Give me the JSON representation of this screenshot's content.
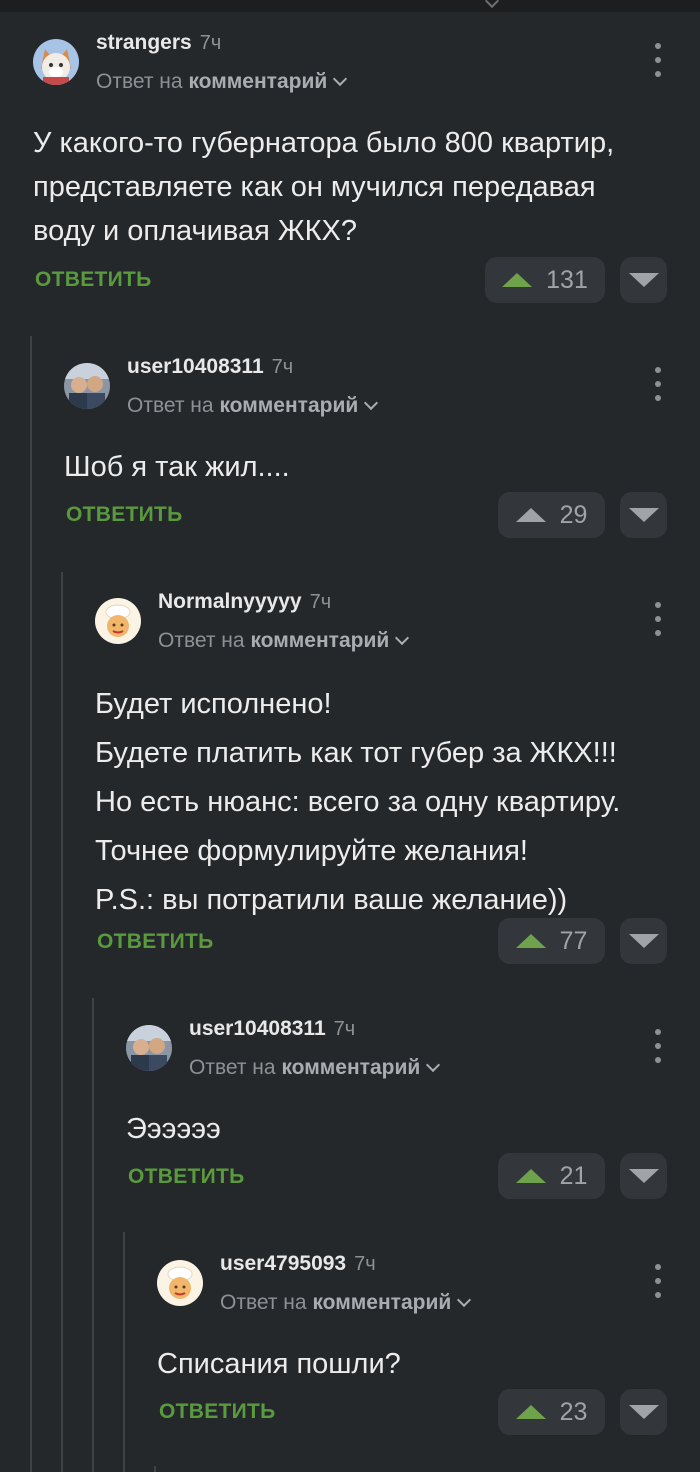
{
  "colors": {
    "background": "#25282b",
    "reply_green": "#5a9a3e",
    "upvote_green": "#6ea34c"
  },
  "comments": [
    {
      "username": "strangers",
      "time": "7ч",
      "reply_prefix": "Ответ на",
      "reply_target": "комментарий",
      "lines": [
        "У какого-то губернатора было 800 квартир,",
        "представляете как он мучился передавая",
        "воду и оплачивая ЖКХ?"
      ],
      "reply_label": "ОТВЕТИТЬ",
      "votes": "131",
      "upvoted": true,
      "avatar": "fox-avatar"
    },
    {
      "username": "user10408311",
      "time": "7ч",
      "reply_prefix": "Ответ на",
      "reply_target": "комментарий",
      "lines": [
        "Шоб я так жил...."
      ],
      "reply_label": "ОТВЕТИТЬ",
      "votes": "29",
      "upvoted": false,
      "avatar": "photo-avatar"
    },
    {
      "username": "Normalnyyyyy",
      "time": "7ч",
      "reply_prefix": "Ответ на",
      "reply_target": "комментарий",
      "lines": [
        "Будет исполнено!",
        "Будете платить как тот губер за ЖКХ!!!",
        "Но есть нюанс: всего за одну квартиру.",
        "Точнее формулируйте желания!",
        "P.S.: вы потратили ваше желание))"
      ],
      "reply_label": "ОТВЕТИТЬ",
      "votes": "77",
      "upvoted": true,
      "avatar": "chef-avatar"
    },
    {
      "username": "user10408311",
      "time": "7ч",
      "reply_prefix": "Ответ на",
      "reply_target": "комментарий",
      "lines": [
        "Ээээээ"
      ],
      "reply_label": "ОТВЕТИТЬ",
      "votes": "21",
      "upvoted": true,
      "avatar": "photo-avatar"
    },
    {
      "username": "user4795093",
      "time": "7ч",
      "reply_prefix": "Ответ на",
      "reply_target": "комментарий",
      "lines": [
        "Списания пошли?"
      ],
      "reply_label": "ОТВЕТИТЬ",
      "votes": "23",
      "upvoted": true,
      "avatar": "chef-avatar"
    }
  ]
}
